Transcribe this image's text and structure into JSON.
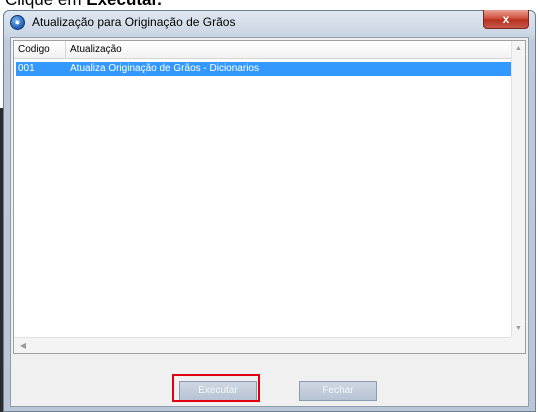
{
  "caption": {
    "prefix": "Clique em ",
    "emphasis": "Executar."
  },
  "window": {
    "title": "Atualização para Originação de Grãos",
    "close_label": "x"
  },
  "grid": {
    "columns": [
      "Codigo",
      "Atualização"
    ],
    "rows": [
      {
        "codigo": "001",
        "atualizacao": "Atualiza Originação de Grãos - Dicionarios",
        "selected": true
      }
    ]
  },
  "buttons": {
    "execute": "Executar",
    "close": "Fechar"
  },
  "colors": {
    "selection": "#3399ff",
    "highlight": "#e0000f"
  }
}
